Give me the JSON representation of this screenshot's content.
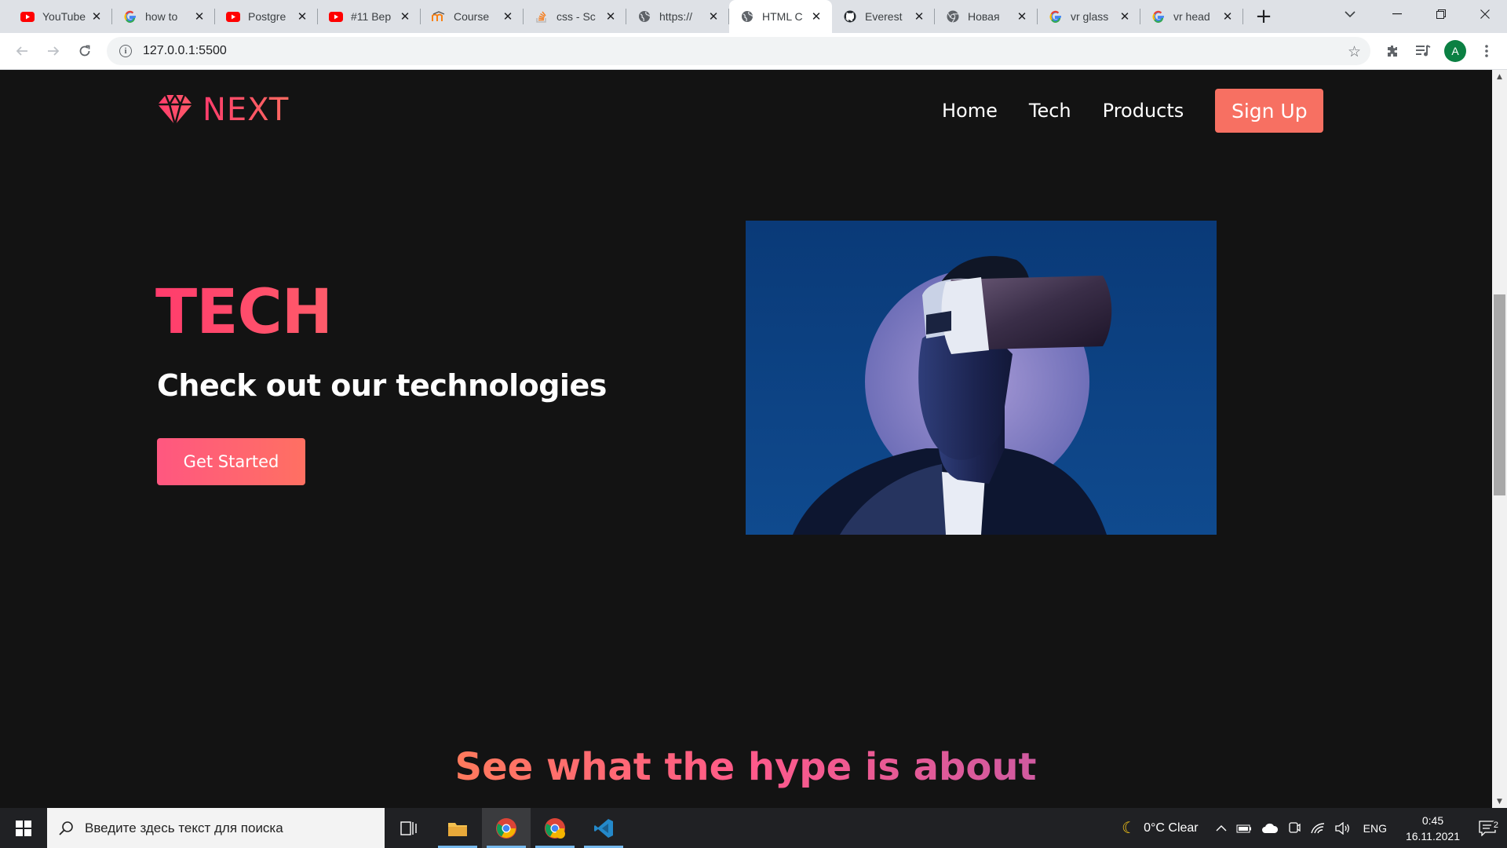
{
  "browser": {
    "tabs": [
      {
        "title": "YouTube",
        "icon": "youtube-icon",
        "close": "✕"
      },
      {
        "title": "how to",
        "icon": "google-icon",
        "close": "✕"
      },
      {
        "title": "Postgre",
        "icon": "youtube-icon",
        "close": "✕"
      },
      {
        "title": "#11 Bep",
        "icon": "youtube-icon",
        "close": "✕"
      },
      {
        "title": "Course",
        "icon": "moodle-icon",
        "close": "✕"
      },
      {
        "title": "css - Sc",
        "icon": "stackoverflow-icon",
        "close": "✕"
      },
      {
        "title": "https://",
        "icon": "globe-icon",
        "close": "✕"
      },
      {
        "title": "HTML C",
        "icon": "globe-icon",
        "close": "✕",
        "active": true
      },
      {
        "title": "Everest",
        "icon": "github-icon",
        "close": "✕"
      },
      {
        "title": "Новая",
        "icon": "chrome-icon",
        "close": "✕"
      },
      {
        "title": "vr glass",
        "icon": "google-icon",
        "close": "✕"
      },
      {
        "title": "vr head",
        "icon": "google-icon",
        "close": "✕"
      }
    ],
    "new_tab": "+",
    "url": "127.0.0.1:5500",
    "profile_initial": "A"
  },
  "page": {
    "logo_text": "NEXT",
    "nav": {
      "home": "Home",
      "tech": "Tech",
      "products": "Products",
      "signup": "Sign Up"
    },
    "hero": {
      "title": "TECH",
      "subtitle": "Check out our technologies",
      "cta": "Get Started"
    },
    "section_heading": "See what the hype is about"
  },
  "taskbar": {
    "search_placeholder": "Введите здесь текст для поиска",
    "weather": "0°C  Clear",
    "lang": "ENG",
    "time": "0:45",
    "date": "16.11.2021",
    "notifications": "2"
  },
  "colors": {
    "page_bg": "#131313",
    "accent_pink": "#ff3c6c",
    "accent_coral": "#f77062",
    "image_bg": "#0f3f78"
  }
}
